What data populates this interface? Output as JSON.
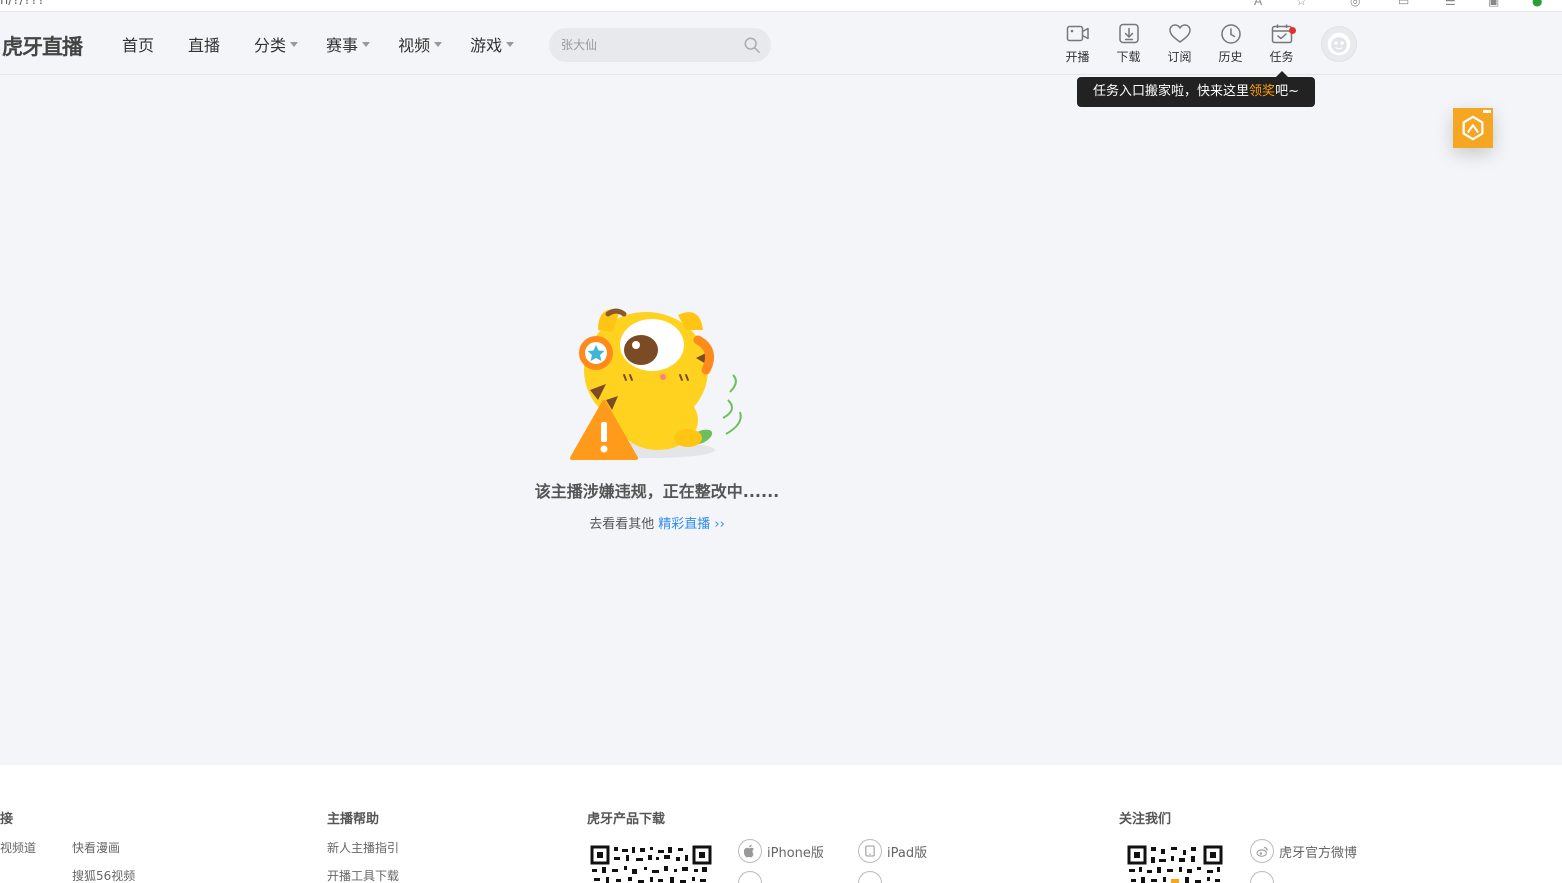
{
  "browser": {
    "url_fragment": "n/?/??? "
  },
  "header": {
    "logo": "虎牙直播",
    "nav": [
      {
        "label": "首页",
        "caret": false
      },
      {
        "label": "直播",
        "caret": false
      },
      {
        "label": "分类",
        "caret": true
      },
      {
        "label": "赛事",
        "caret": true
      },
      {
        "label": "视频",
        "caret": true
      },
      {
        "label": "游戏",
        "caret": true
      }
    ],
    "search_placeholder": "张大仙",
    "tools": [
      {
        "label": "开播",
        "icon": "camera-icon"
      },
      {
        "label": "下载",
        "icon": "download-icon"
      },
      {
        "label": "订阅",
        "icon": "heart-icon"
      },
      {
        "label": "历史",
        "icon": "clock-icon"
      },
      {
        "label": "任务",
        "icon": "calendar-icon"
      }
    ]
  },
  "tooltip": {
    "prefix": "任务入口搬家啦，快来这里",
    "highlight": "领奖",
    "suffix": "吧~"
  },
  "main": {
    "message": "该主播涉嫌违规，正在整改中......",
    "sub_text": "去看看其他",
    "sub_link": "精彩直播 ››"
  },
  "footer": {
    "col1": {
      "title": "接",
      "links": [
        "视频道",
        "快看漫画",
        "搜狐56视频"
      ]
    },
    "col2": {
      "title": "主播帮助",
      "links": [
        "新人主播指引",
        "开播工具下载"
      ]
    },
    "col3": {
      "title": "虎牙产品下载",
      "downloads": [
        "iPhone版",
        "iPad版"
      ]
    },
    "col4": {
      "title": "关注我们",
      "links": [
        "虎牙官方微博"
      ]
    }
  },
  "colors": {
    "accent_orange": "#ff9f00",
    "link_blue": "#2d8cf0",
    "badge_orange": "#f5a623",
    "tooltip_bg": "#222222"
  }
}
